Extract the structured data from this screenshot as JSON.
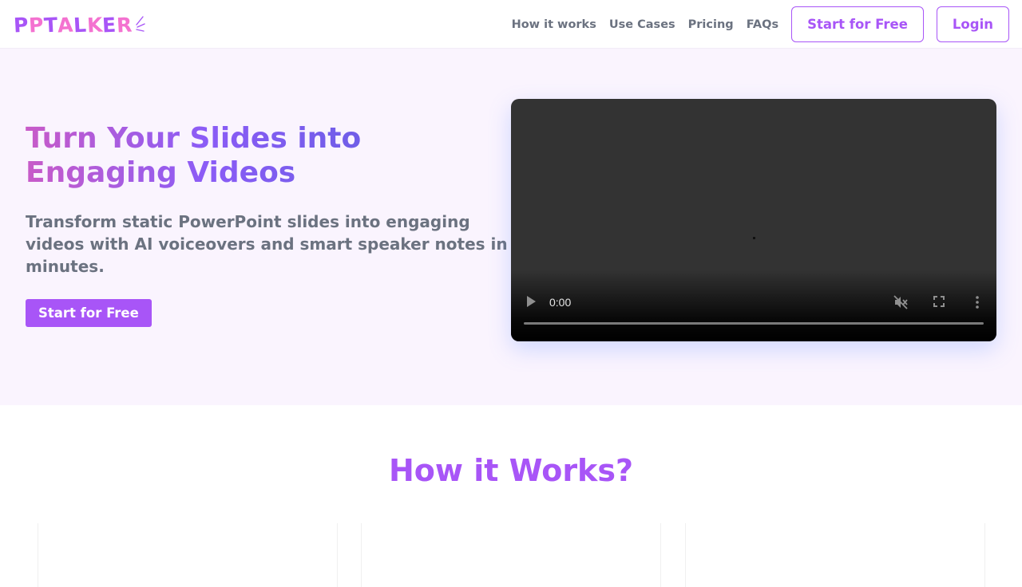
{
  "header": {
    "logo_letters": [
      "P",
      "P",
      "T",
      "A",
      "L",
      "K",
      "E",
      "R"
    ],
    "nav": [
      "How it works",
      "Use Cases",
      "Pricing",
      "FAQs"
    ],
    "start_button": "Start for Free",
    "login_button": "Login"
  },
  "hero": {
    "title_line1": "Turn Your Slides into",
    "title_line2": "Engaging Videos",
    "subtitle": "Transform static PowerPoint slides into engaging videos with AI voiceovers and smart speaker notes in minutes.",
    "cta": "Start for Free"
  },
  "video": {
    "time": "0:00",
    "progress": 0,
    "icons": [
      "play-icon",
      "muted-icon",
      "fullscreen-icon",
      "more-vertical-icon"
    ]
  },
  "how": {
    "title": "How it Works?"
  },
  "colors": {
    "accent": "#a855f7",
    "hero_bg": "#faf4fe",
    "text_muted": "#6b7280",
    "logo_pink": "#f472d0"
  }
}
